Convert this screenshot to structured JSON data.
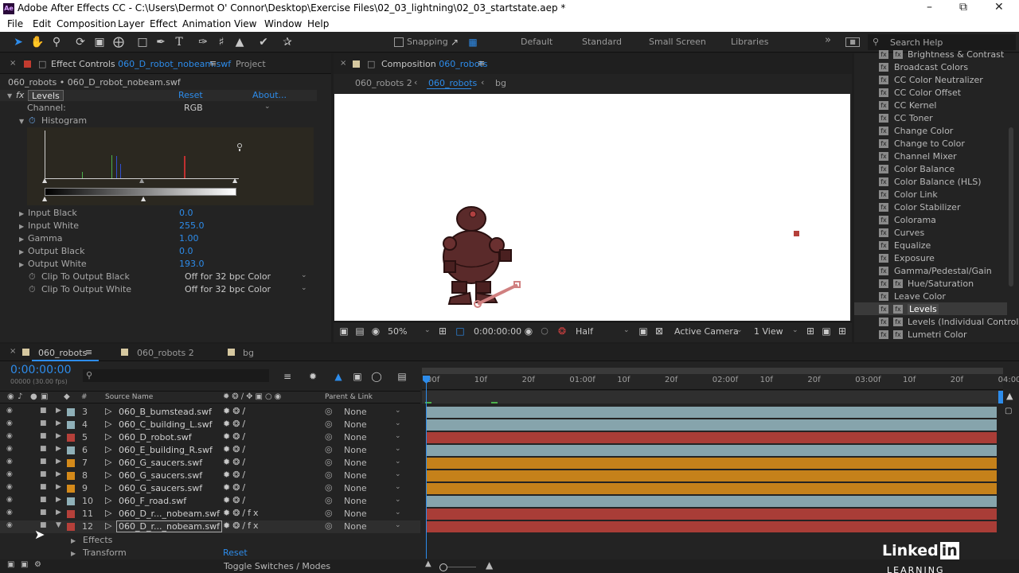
{
  "window": {
    "app_title": "Adobe After Effects CC - C:\\Users\\Dermot O' Connor\\Desktop\\Exercise Files\\02_03_lightning\\02_03_startstate.aep *"
  },
  "menu": [
    "File",
    "Edit",
    "Composition",
    "Layer",
    "Effect",
    "Animation",
    "View",
    "Window",
    "Help"
  ],
  "toolbar": {
    "snapping_label": "Snapping",
    "workspaces": [
      "Default",
      "Standard",
      "Small Screen",
      "Libraries"
    ],
    "search_placeholder": "Search Help"
  },
  "effect_controls": {
    "tab_label": "Effect Controls",
    "tab_layer": "060_D_robot_nobeam.swf",
    "project_tab": "Project",
    "breadcrumb": "060_robots • 060_D_robot_nobeam.swf",
    "effect_name": "Levels",
    "reset_label": "Reset",
    "about_label": "About...",
    "channel_label": "Channel:",
    "channel_value": "RGB",
    "histogram_label": "Histogram",
    "params": [
      {
        "label": "Input Black",
        "value": "0.0"
      },
      {
        "label": "Input White",
        "value": "255.0"
      },
      {
        "label": "Gamma",
        "value": "1.00"
      },
      {
        "label": "Output Black",
        "value": "0.0"
      },
      {
        "label": "Output White",
        "value": "193.0"
      }
    ],
    "clip_black_label": "Clip To Output Black",
    "clip_black_value": "Off for 32 bpc Color",
    "clip_white_label": "Clip To Output White",
    "clip_white_value": "Off for 32 bpc Color"
  },
  "composition": {
    "tab_prefix": "Composition",
    "tab_name": "060_robots",
    "breadcrumbs": [
      "060_robots 2",
      "060_robots",
      "bg"
    ],
    "zoom": "50%",
    "timecode": "0:00:00:00",
    "resolution": "Half",
    "camera": "Active Camera",
    "views": "1 View"
  },
  "effects_list": {
    "items": [
      "Brightness & Contrast",
      "Broadcast Colors",
      "CC Color Neutralizer",
      "CC Color Offset",
      "CC Kernel",
      "CC Toner",
      "Change Color",
      "Change to Color",
      "Channel Mixer",
      "Color Balance",
      "Color Balance (HLS)",
      "Color Link",
      "Color Stabilizer",
      "Colorama",
      "Curves",
      "Equalize",
      "Exposure",
      "Gamma/Pedestal/Gain",
      "Hue/Saturation",
      "Leave Color",
      "Levels",
      "Levels (Individual Controls)",
      "Lumetri Color"
    ],
    "selected": "Levels"
  },
  "timeline": {
    "tabs": [
      "060_robots",
      "060_robots 2",
      "bg"
    ],
    "timecode": "0:00:00:00",
    "fps_note": "00000 (30.00 fps)",
    "col_source": "Source Name",
    "col_parent": "Parent & Link",
    "ruler": [
      "00f",
      "10f",
      "20f",
      "01:00f",
      "10f",
      "20f",
      "02:00f",
      "10f",
      "20f",
      "03:00f",
      "10f",
      "20f",
      "04:00"
    ],
    "layers": [
      {
        "num": "3",
        "name": "060_B_bumstead.swf",
        "color": "#8fb0b8",
        "parent": "None"
      },
      {
        "num": "4",
        "name": "060_C_building_L.swf",
        "color": "#8fb0b8",
        "parent": "None"
      },
      {
        "num": "5",
        "name": "060_D_robot.swf",
        "color": "#b5403a",
        "parent": "None"
      },
      {
        "num": "6",
        "name": "060_E_building_R.swf",
        "color": "#8fb0b8",
        "parent": "None"
      },
      {
        "num": "7",
        "name": "060_G_saucers.swf",
        "color": "#d48a1a",
        "parent": "None"
      },
      {
        "num": "8",
        "name": "060_G_saucers.swf",
        "color": "#d48a1a",
        "parent": "None"
      },
      {
        "num": "9",
        "name": "060_G_saucers.swf",
        "color": "#d48a1a",
        "parent": "None"
      },
      {
        "num": "10",
        "name": "060_F_road.swf",
        "color": "#8fb0b8",
        "parent": "None"
      },
      {
        "num": "11",
        "name": "060_D_r..._nobeam.swf",
        "color": "#b5403a",
        "parent": "None"
      },
      {
        "num": "12",
        "name": "060_D_r..._nobeam.swf",
        "color": "#b5403a",
        "parent": "None"
      }
    ],
    "sub_effects": "Effects",
    "sub_transform": "Transform",
    "transform_reset": "Reset",
    "toggle_label": "Toggle Switches / Modes"
  },
  "watermark": {
    "brand": "Linked",
    "brand_in": "in",
    "learning": "LEARNING"
  }
}
